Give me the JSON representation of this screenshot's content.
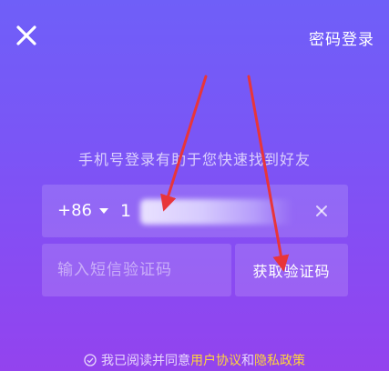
{
  "header": {
    "password_login_label": "密码登录"
  },
  "subtitle": "手机号登录有助于您快速找到好友",
  "phone": {
    "country_code": "+86",
    "value": "1",
    "placeholder": ""
  },
  "code": {
    "placeholder": "输入短信验证码",
    "get_code_label": "获取验证码"
  },
  "agreement": {
    "prefix": "我已阅读并同意",
    "user_agreement": "用户协议",
    "and": "和",
    "privacy_policy": "隐私政策"
  },
  "colors": {
    "background_top": "#6f5ff8",
    "background_bottom": "#9343ee",
    "link": "#ffd43a",
    "annotation_arrow": "#e8353a"
  }
}
